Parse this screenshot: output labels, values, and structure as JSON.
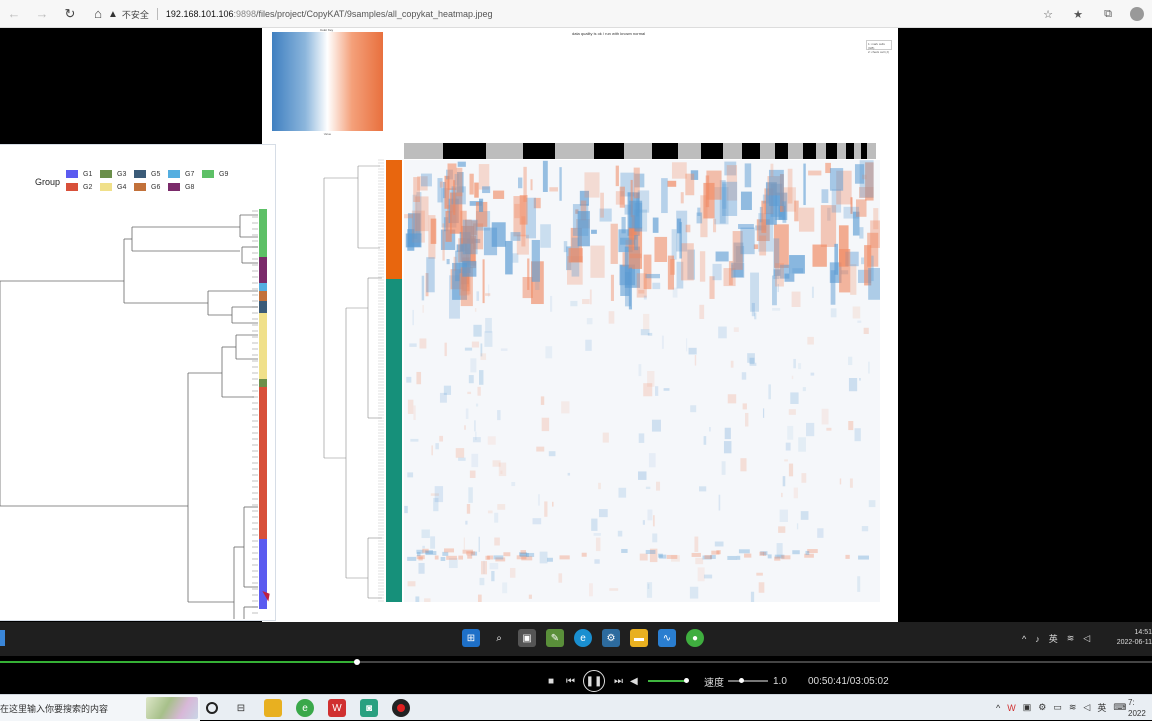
{
  "browser": {
    "security_label": "不安全",
    "url_host": "192.168.101.106",
    "url_port": ":9898",
    "url_path": "/files/project/CopyKAT/9samples/all_copykat_heatmap.jpeg"
  },
  "heatmap": {
    "key_title": "Color Key",
    "key_axis": "Value",
    "title": "data quality is ok / run with known normal",
    "legend_line1": "1: mark cells (GB)",
    "legend_line2": "2: check cell (J)"
  },
  "group_panel": {
    "title": "Group",
    "groups": [
      {
        "label": "G1",
        "color": "#5b5bf0"
      },
      {
        "label": "G3",
        "color": "#6b8f4a"
      },
      {
        "label": "G5",
        "color": "#3b5b78"
      },
      {
        "label": "G7",
        "color": "#54aee0"
      },
      {
        "label": "G9",
        "color": "#5dc066"
      },
      {
        "label": "G2",
        "color": "#d8503a"
      },
      {
        "label": "G4",
        "color": "#f0e08a"
      },
      {
        "label": "G6",
        "color": "#c2713a"
      },
      {
        "label": "G8",
        "color": "#7a2a6a"
      }
    ]
  },
  "taskbar": {
    "tray_ime": "英",
    "clock_time": "14:51",
    "clock_date": "2022-06-11"
  },
  "player": {
    "progress_fraction": 0.31,
    "speed_label": "速度",
    "speed_value": "1.0",
    "time": "00:50:41/03:05:02"
  },
  "win_taskbar": {
    "search_placeholder": "在这里输入你要搜索的内容",
    "ime": "英",
    "clock_time": "7:",
    "clock_date": "2022"
  },
  "colors": {
    "annot_orange": "#e8660e",
    "annot_teal": "#16907a",
    "heat_red": "#f08860",
    "heat_blue": "#5a9ad2"
  }
}
